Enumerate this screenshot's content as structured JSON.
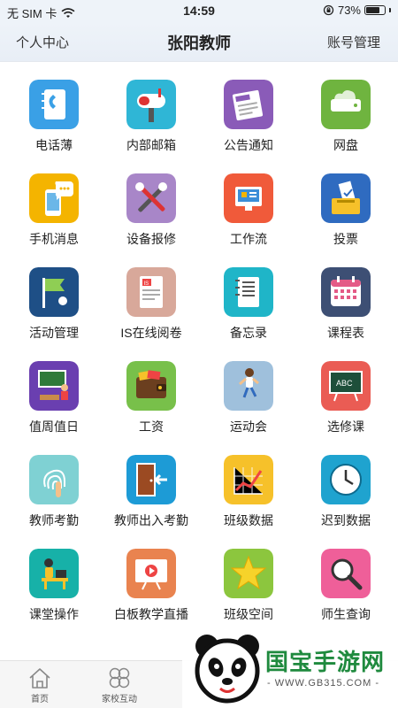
{
  "status_bar": {
    "carrier": "无 SIM 卡",
    "time": "14:59",
    "battery_text": "73%",
    "battery_level": 0.73
  },
  "nav": {
    "left": "个人中心",
    "title": "张阳教师",
    "right": "账号管理"
  },
  "apps": [
    {
      "label": "电话薄",
      "icon": "phonebook-icon",
      "color": "#3aa0e6"
    },
    {
      "label": "内部邮箱",
      "icon": "mailbox-icon",
      "color": "#2fb6d6"
    },
    {
      "label": "公告通知",
      "icon": "newspaper-icon",
      "color": "#8a5bb8"
    },
    {
      "label": "网盘",
      "icon": "cloud-drive-icon",
      "color": "#6fb43f"
    },
    {
      "label": "手机消息",
      "icon": "phone-message-icon",
      "color": "#f4b400"
    },
    {
      "label": "设备报修",
      "icon": "tools-icon",
      "color": "#a886c8"
    },
    {
      "label": "工作流",
      "icon": "workflow-icon",
      "color": "#f05a3a"
    },
    {
      "label": "投票",
      "icon": "ballot-box-icon",
      "color": "#2f6bc0"
    },
    {
      "label": "活动管理",
      "icon": "flag-icon",
      "color": "#1e4f86"
    },
    {
      "label": "IS在线阅卷",
      "icon": "exam-paper-icon",
      "color": "#d8a89a"
    },
    {
      "label": "备忘录",
      "icon": "notebook-icon",
      "color": "#1fb5c8"
    },
    {
      "label": "课程表",
      "icon": "calendar-icon",
      "color": "#3d4f74"
    },
    {
      "label": "值周值日",
      "icon": "classroom-icon",
      "color": "#6a3fb0"
    },
    {
      "label": "工资",
      "icon": "wallet-icon",
      "color": "#78c04a"
    },
    {
      "label": "运动会",
      "icon": "runner-icon",
      "color": "#9fc0dc"
    },
    {
      "label": "选修课",
      "icon": "blackboard-icon",
      "color": "#ea5c54"
    },
    {
      "label": "教师考勤",
      "icon": "fingerprint-icon",
      "color": "#7fd1d3"
    },
    {
      "label": "教师出入考勤",
      "icon": "door-exit-icon",
      "color": "#1d9bd6"
    },
    {
      "label": "班级数据",
      "icon": "chart-grid-icon",
      "color": "#f6c12a"
    },
    {
      "label": "迟到数据",
      "icon": "clock-icon",
      "color": "#1fa3cf"
    },
    {
      "label": "课堂操作",
      "icon": "student-desk-icon",
      "color": "#17b1a8"
    },
    {
      "label": "白板教学直播",
      "icon": "whiteboard-video-icon",
      "color": "#e9834f"
    },
    {
      "label": "班级空间",
      "icon": "star-icon",
      "color": "#8cc63e"
    },
    {
      "label": "师生查询",
      "icon": "magnifier-icon",
      "color": "#ef5f99"
    }
  ],
  "tabbar": {
    "home": "首页",
    "interaction": "家校互动"
  },
  "watermark": {
    "brand": "国宝手游网",
    "url": "- WWW.GB315.COM -"
  }
}
